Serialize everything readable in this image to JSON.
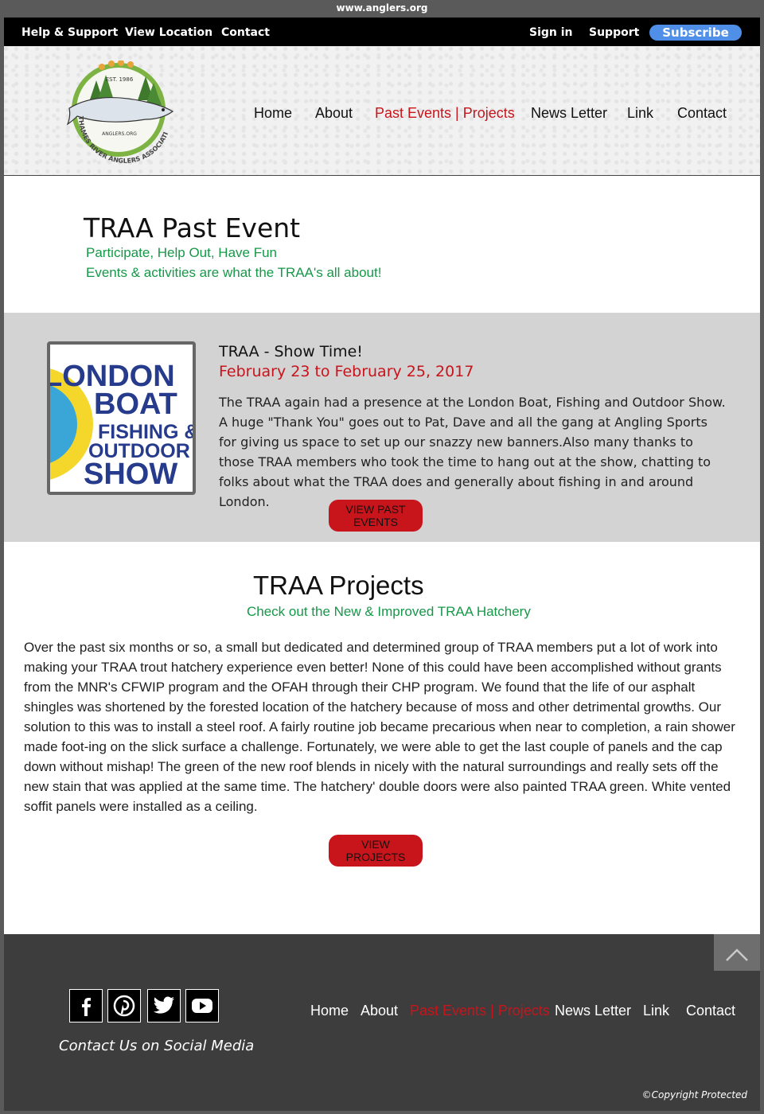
{
  "browser": {
    "url": "www.anglers.org"
  },
  "topbar": {
    "links": [
      "Help & Support",
      "View Location",
      "Contact"
    ],
    "sign_in": "Sign in",
    "support": "Support",
    "subscribe": "Subscribe"
  },
  "logo": {
    "est": "EST. 1986",
    "site": "ANGLERS.ORG",
    "name": "THAMES RIVER ANGLERS ASSOCIATION"
  },
  "nav": {
    "items": [
      "Home",
      "About",
      "Past Events | Projects",
      "News Letter",
      "Link",
      "Contact"
    ],
    "active": "Past Events | Projects"
  },
  "past_event": {
    "title": "TRAA Past Event",
    "subtitle_1": "Participate, Help Out, Have Fun",
    "subtitle_2": "Events & activities are what the TRAA's all about!"
  },
  "event": {
    "image_lines": [
      "LONDON",
      "BOAT",
      "FISHING &",
      "OUTDOOR",
      "SHOW"
    ],
    "title": "TRAA - Show Time!",
    "date": "February 23 to February 25, 2017",
    "text": "The TRAA again had a presence at the London Boat, Fishing and Outdoor Show. A huge \"Thank You\" goes out to Pat, Dave and all the gang at Angling Sports for giving us space to set up our snazzy new banners.Also many thanks to those TRAA members who took the time to hang out at the show, chatting to folks about what the TRAA does and generally about fishing in and around London.",
    "button": "VIEW PAST EVENTS"
  },
  "projects": {
    "title": "TRAA Projects",
    "subtitle": "Check out the New & Improved TRAA Hatchery",
    "text": "Over the past six months or so, a small but dedicated and determined group of TRAA members put a lot of work into making your TRAA trout hatchery experience even better! None of this could have been accomplished without grants from the MNR's CFWIP program and the OFAH through their CHP program. We found that the life of our asphalt shingles was shortened by the forested location of the hatchery because of moss and other detrimental growths. Our solution to this was to install a steel roof. A fairly routine job became precarious when near to completion, a rain shower made foot-ing on the slick surface a challenge. Fortunately, we were able to get the last couple of panels and the cap down without mishap! The green of the new roof blends in nicely with the natural surroundings and really sets off the new stain that was applied at the same time. The hatchery' double doors were also painted TRAA green. White vented soffit panels were installed as a ceiling.",
    "button": "VIEW PROJECTS"
  },
  "footer": {
    "social_icons": [
      "facebook-icon",
      "pinterest-icon",
      "twitter-icon",
      "youtube-icon"
    ],
    "contact_social": "Contact Us on Social Media",
    "copyright": "©Copyright Protected"
  },
  "colors": {
    "accent_red": "#c8141b",
    "green": "#169848",
    "subscribe_blue": "#4f8fe8"
  }
}
